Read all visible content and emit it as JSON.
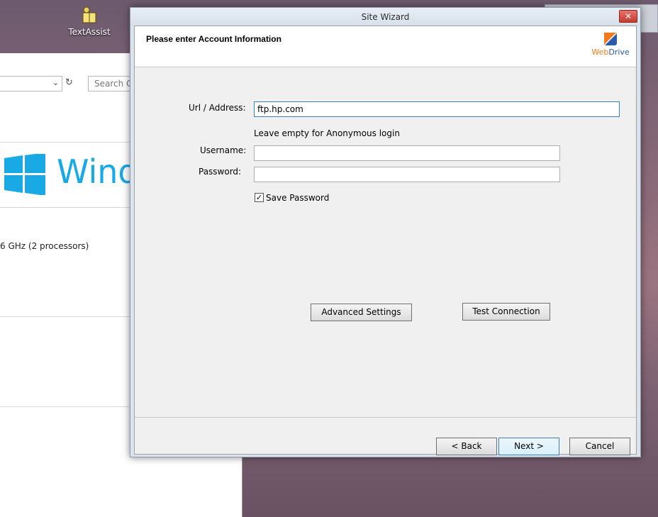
{
  "desktop": {
    "icon_label": "TextAssist"
  },
  "background_window": {
    "search_placeholder": "Search Co",
    "windows_text": "Wind",
    "cpu_text": "6 GHz  (2 processors)"
  },
  "dialog": {
    "title": "Site Wizard",
    "close_label": "✕",
    "heading": "Please enter Account Information",
    "logo": {
      "web": "Web",
      "drive": "Drive"
    },
    "url_label": "Url / Address:",
    "url_value": "ftp.hp.com",
    "anonymous_hint": "Leave empty for Anonymous login",
    "username_label": "Username:",
    "username_value": "",
    "password_label": "Password:",
    "password_value": "",
    "save_password_label": "Save Password",
    "save_password_checked": true,
    "advanced_settings_label": "Advanced Settings",
    "test_connection_label": "Test Connection",
    "back_label": "< Back",
    "next_label": "Next >",
    "cancel_label": "Cancel"
  },
  "colors": {
    "accent": "#3c7fb1",
    "windows_blue": "#19a9e4",
    "webdrive_orange": "#f07b1d",
    "webdrive_blue": "#2b5aa6"
  }
}
